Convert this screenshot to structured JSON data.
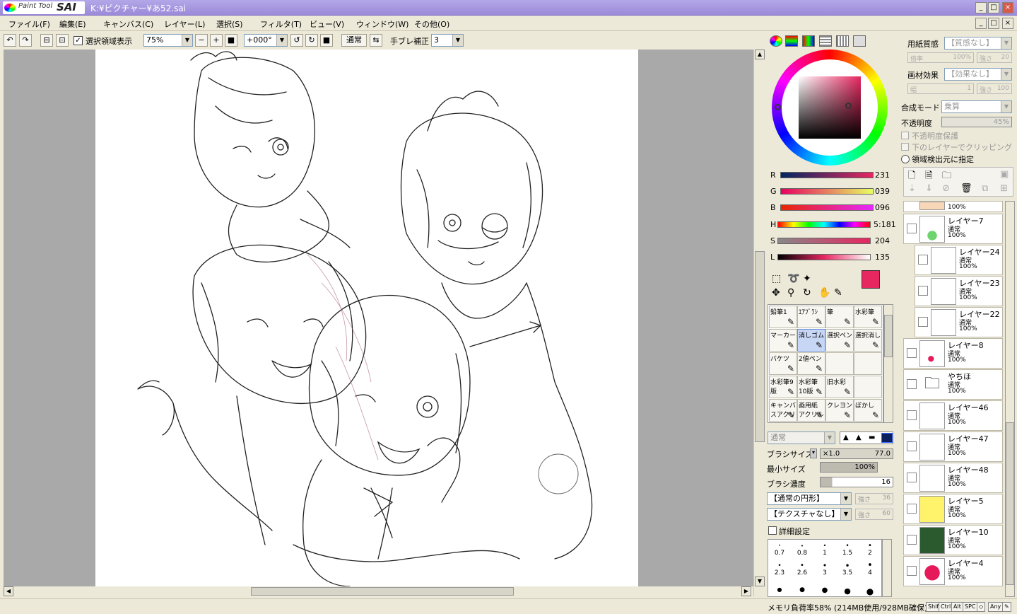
{
  "app": {
    "logo_small": "Paint Tool",
    "logo_big": "SAI",
    "title": "K:¥ピクチャー¥あ52.sai"
  },
  "window_buttons": {
    "min": "_",
    "max": "□",
    "close": "×"
  },
  "menu": [
    "ファイル(F)",
    "編集(E)",
    "キャンバス(C)",
    "レイヤー(L)",
    "選択(S)",
    "フィルタ(T)",
    "ビュー(V)",
    "ウィンドウ(W)",
    "その他(O)"
  ],
  "toolbar": {
    "show_selection": "選択領域表示",
    "zoom": "75%",
    "rotation": "+000°",
    "mode": "通常",
    "stabilizer_label": "手ブレ補正",
    "stabilizer_value": "3"
  },
  "color": {
    "R": {
      "label": "R",
      "value": "231"
    },
    "G": {
      "label": "G",
      "value": "039"
    },
    "B": {
      "label": "B",
      "value": "096"
    },
    "H": {
      "label": "H",
      "value": "5:181"
    },
    "S": {
      "label": "S",
      "value": "204"
    },
    "L": {
      "label": "L",
      "value": "135"
    },
    "primary": "#e72760",
    "secondary": "#5c3a1e"
  },
  "brushes": [
    {
      "label": "鉛筆1"
    },
    {
      "label": "ｴｱﾌﾞﾗｼ"
    },
    {
      "label": "筆"
    },
    {
      "label": "水彩筆"
    },
    {
      "label": "マーカー"
    },
    {
      "label": "消しゴム"
    },
    {
      "label": "選択ペン"
    },
    {
      "label": "選択消し"
    },
    {
      "label": "バケツ"
    },
    {
      "label": "2値ペン"
    },
    {
      "label": ""
    },
    {
      "label": ""
    },
    {
      "label": "水彩筆9版"
    },
    {
      "label": "水彩筆10版"
    },
    {
      "label": "旧水彩"
    },
    {
      "label": ""
    },
    {
      "label": "キャンバスアクリル"
    },
    {
      "label": "画用紙アクリル"
    },
    {
      "label": "クレヨン"
    },
    {
      "label": "ぼかし"
    }
  ],
  "brush_props": {
    "blend": "通常",
    "size_label": "ブラシサイズ",
    "size_mult": "×1.0",
    "size_value": "77.0",
    "min_label": "最小サイズ",
    "min_value": "100%",
    "density_label": "ブラシ濃度",
    "density_value": "16",
    "shape": "【通常の円形】",
    "shape_strength": "強さ",
    "shape_strength_val": "36",
    "texture": "【テクスチャなし】",
    "tex_strength": "強さ",
    "tex_strength_val": "60",
    "detail": "詳細設定"
  },
  "dots": [
    [
      "0.7",
      "0.8",
      "1",
      "1.5",
      "2"
    ],
    [
      "2.3",
      "2.6",
      "3",
      "3.5",
      "4"
    ]
  ],
  "right": {
    "paper_label": "用紙質感",
    "paper_value": "【質感なし】",
    "paper_scale_label": "倍率",
    "paper_scale": "100%",
    "paper_str_label": "強さ",
    "paper_str": "20",
    "effect_label": "画材効果",
    "effect_value": "【効果なし】",
    "width_label": "幅",
    "width_val": "1",
    "eff_str_label": "強さ",
    "eff_str": "100",
    "blend_label": "合成モード",
    "blend_value": "乗算",
    "opacity_label": "不透明度",
    "opacity_value": "45%",
    "protect": "不透明度保護",
    "clip": "下のレイヤーでクリッピング",
    "source": "領域検出元に指定"
  },
  "layers": [
    {
      "name": "レイヤー7",
      "mode": "通常",
      "opacity": "100%"
    },
    {
      "name": "レイヤー24",
      "mode": "通常",
      "opacity": "100%"
    },
    {
      "name": "レイヤー23",
      "mode": "通常",
      "opacity": "100%"
    },
    {
      "name": "レイヤー22",
      "mode": "通常",
      "opacity": "100%"
    },
    {
      "name": "レイヤー8",
      "mode": "通常",
      "opacity": "100%"
    },
    {
      "name": "やちほ",
      "mode": "通常",
      "opacity": "100%"
    },
    {
      "name": "レイヤー46",
      "mode": "通常",
      "opacity": "100%"
    },
    {
      "name": "レイヤー47",
      "mode": "通常",
      "opacity": "100%"
    },
    {
      "name": "レイヤー48",
      "mode": "通常",
      "opacity": "100%"
    },
    {
      "name": "レイヤー5",
      "mode": "通常",
      "opacity": "100%"
    },
    {
      "name": "レイヤー10",
      "mode": "通常",
      "opacity": "100%"
    },
    {
      "name": "レイヤー4",
      "mode": "通常",
      "opacity": "100%"
    }
  ],
  "top_layer_opacity": "100%",
  "status": {
    "memory": "メモリ負荷率58% (214MB使用/928MB確保)",
    "keys": [
      "Shift",
      "Ctrl",
      "Alt",
      "SPC",
      "◇",
      "Any",
      "✎"
    ]
  }
}
